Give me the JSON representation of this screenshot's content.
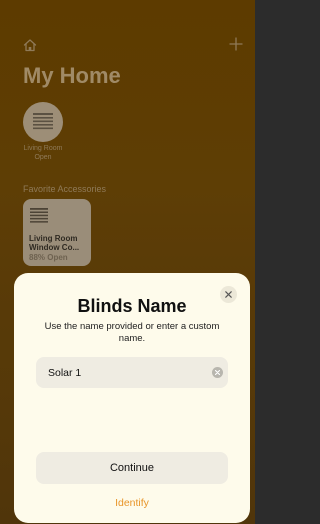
{
  "background_home": {
    "title": "My Home",
    "room": {
      "label": "Living Room",
      "status": "Open"
    },
    "favorites_header": "Favorite Accessories",
    "accessory": {
      "name": "Living Room Window Co...",
      "status": "88% Open"
    }
  },
  "sheet": {
    "title": "Blinds Name",
    "subtitle": "Use the name provided or enter a custom name.",
    "name_field": {
      "value": "Solar 1"
    },
    "continue_label": "Continue",
    "identify_label": "Identify"
  },
  "colors": {
    "sheet_bg": "#fefbeb",
    "accent_orange": "#e8952a",
    "home_bg": "#6a4400"
  }
}
